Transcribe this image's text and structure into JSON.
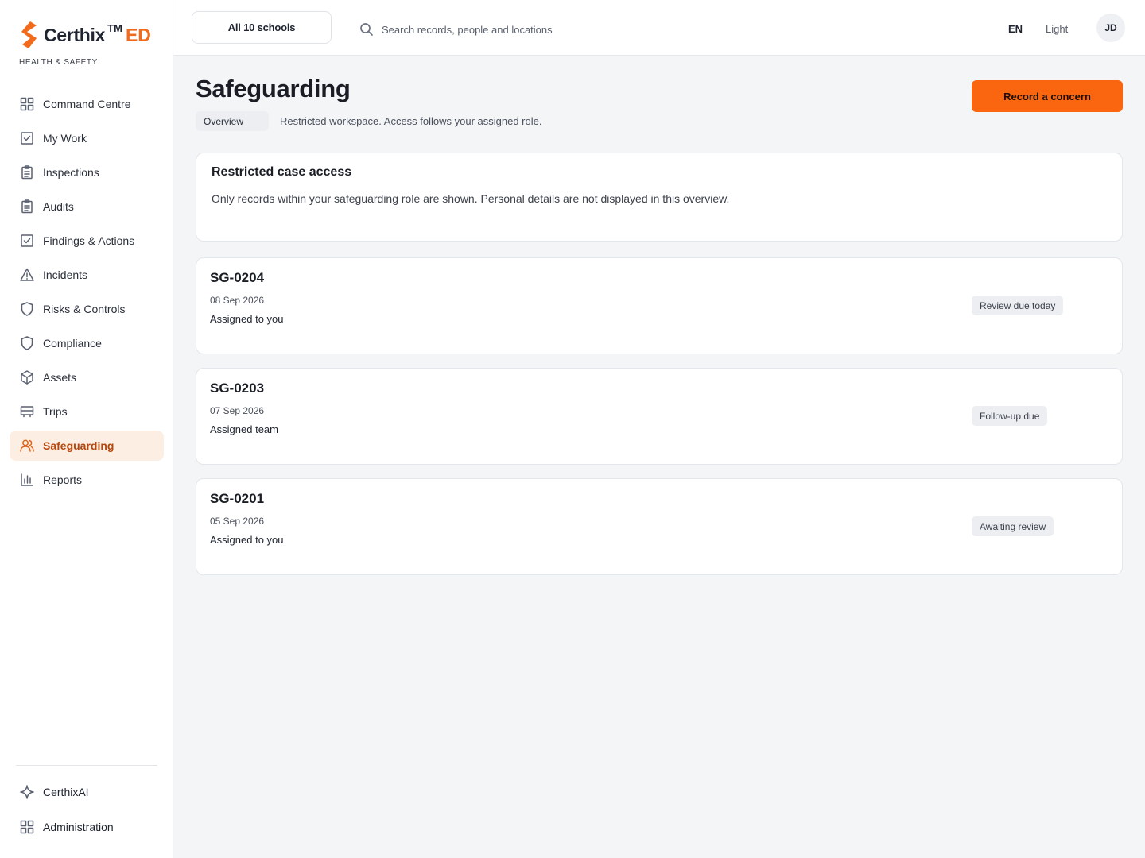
{
  "brand": {
    "name": "Certhix",
    "tm": "TM",
    "suffix": "ED",
    "subtitle": "HEALTH & SAFETY",
    "accent_color": "#f26a1b"
  },
  "sidebar": {
    "items": [
      {
        "label": "Command Centre",
        "icon": "grid-icon"
      },
      {
        "label": "My Work",
        "icon": "checkbox-icon"
      },
      {
        "label": "Inspections",
        "icon": "clipboard-icon"
      },
      {
        "label": "Audits",
        "icon": "clipboard-icon"
      },
      {
        "label": "Findings & Actions",
        "icon": "checkbox-icon"
      },
      {
        "label": "Incidents",
        "icon": "warning-icon"
      },
      {
        "label": "Risks & Controls",
        "icon": "shield-icon"
      },
      {
        "label": "Compliance",
        "icon": "shield-icon"
      },
      {
        "label": "Assets",
        "icon": "cube-icon"
      },
      {
        "label": "Trips",
        "icon": "bus-icon"
      },
      {
        "label": "Safeguarding",
        "icon": "people-icon",
        "active": true
      },
      {
        "label": "Reports",
        "icon": "bar-chart-icon"
      }
    ],
    "bottom": [
      {
        "label": "CerthixAI",
        "icon": "sparkle-icon"
      },
      {
        "label": "Administration",
        "icon": "grid-icon"
      }
    ]
  },
  "topbar": {
    "school_select": "All 10 schools",
    "search_placeholder": "Search records, people and locations",
    "language": "EN",
    "theme": "Light",
    "avatar_initials": "JD"
  },
  "main": {
    "title": "Safeguarding",
    "tab": "Overview",
    "subtitle": "Restricted workspace. Access follows your assigned role.",
    "primary_button": "Record a concern",
    "primary_color": "#fa650f",
    "notice": {
      "title": "Restricted case access",
      "text": "Only records within your safeguarding role are shown. Personal details are not displayed in this overview."
    },
    "cases": [
      {
        "id": "SG-0204",
        "date": "08 Sep 2026",
        "assigned": "Assigned to you",
        "status": "Review due today"
      },
      {
        "id": "SG-0203",
        "date": "07 Sep 2026",
        "assigned": "Assigned team",
        "status": "Follow-up due"
      },
      {
        "id": "SG-0201",
        "date": "05 Sep 2026",
        "assigned": "Assigned to you",
        "status": "Awaiting review"
      }
    ]
  }
}
